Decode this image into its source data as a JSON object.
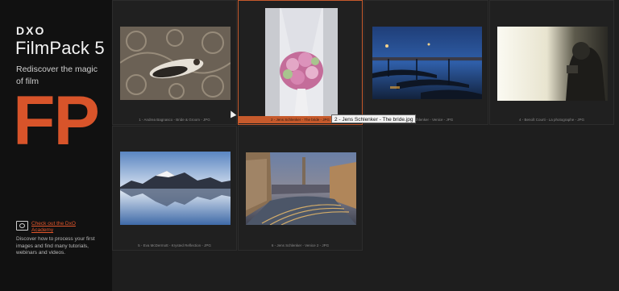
{
  "sidebar": {
    "brand": "DXO",
    "product": "FilmPack 5",
    "tagline": "Rediscover the magic of film",
    "mark": "FP",
    "academy": {
      "link": "Check out the DxO Academy",
      "description": "Discover how to process your first images and find many tutorials, webinars and videos."
    }
  },
  "grid": {
    "items": [
      {
        "caption": "1 - Andrea Bagnasco - Bride & Groom - JPG"
      },
      {
        "caption": "2 - Jens Schlenker - The bride - JPG"
      },
      {
        "caption": "3 - Jens Schlenker - Venice - JPG"
      },
      {
        "caption": "4 - Benoît Courti - La photographe - JPG"
      },
      {
        "caption": "5 - Eva McDermott - Krysted Reflection - JPG"
      },
      {
        "caption": "6 - Jens Schlenker - Venice 2 - JPG"
      }
    ]
  },
  "tooltip": "2 - Jens Schlenker - The bride.jpg",
  "colors": {
    "accent": "#d8542a",
    "selection": "#c65a2c",
    "background": "#1e1e1e",
    "sidebar": "#111111"
  }
}
